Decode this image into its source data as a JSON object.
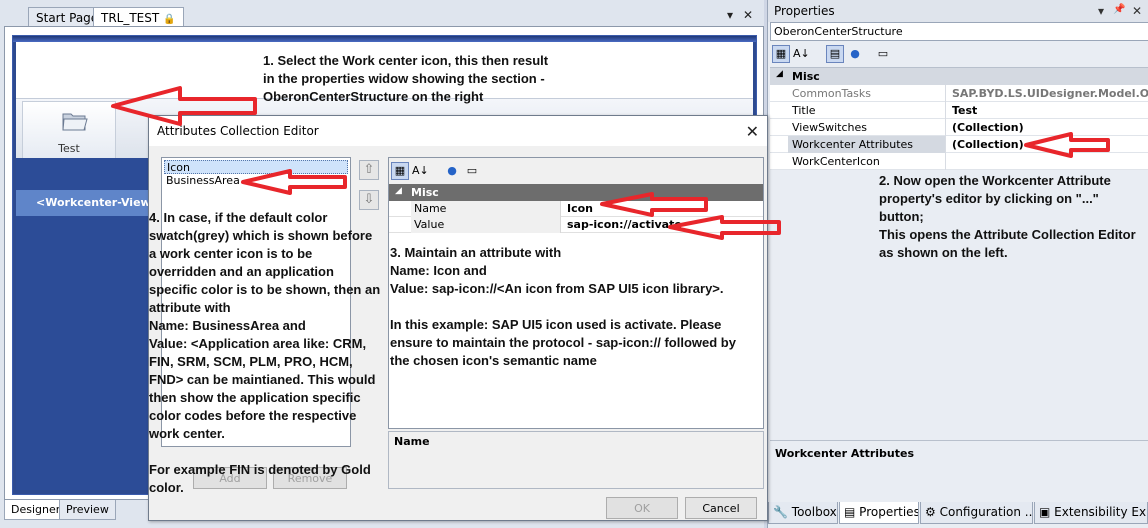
{
  "document": {
    "tabs": [
      {
        "label": "Start Page"
      },
      {
        "label": "TRL_TEST"
      }
    ],
    "pin_glyph": "🔒",
    "controls": {
      "dropdown": "▾",
      "close": "✕"
    },
    "bottom_tabs": [
      {
        "label": "Designer"
      },
      {
        "label": "Preview"
      }
    ]
  },
  "workcenter": {
    "tile_label": "Test",
    "tile_icon": "folder-icon",
    "view_title": "<Workcenter-View Titl"
  },
  "properties_panel": {
    "title": "Properties",
    "controls": {
      "dropdown": "▾",
      "pin": "📌",
      "close": "✕"
    },
    "selected_object": "OberonCenterStructure",
    "category": "Misc",
    "rows": [
      {
        "name": "CommonTasks",
        "value": "SAP.BYD.LS.UIDesigner.Model.Oberon"
      },
      {
        "name": "Title",
        "value": "Test"
      },
      {
        "name": "ViewSwitches",
        "value": "(Collection)"
      },
      {
        "name": "Workcenter Attributes",
        "value": "(Collection)"
      },
      {
        "name": "WorkCenterIcon",
        "value": ""
      }
    ],
    "description_title": "Workcenter Attributes",
    "bottom_tabs": [
      {
        "label": "Toolbox",
        "icon": "wrench-icon"
      },
      {
        "label": "Properties",
        "icon": "properties-icon"
      },
      {
        "label": "Configuration ...",
        "icon": "config-icon"
      },
      {
        "label": "Extensibility Ex...",
        "icon": "extensibility-icon"
      }
    ]
  },
  "dialog": {
    "title": "Attributes Collection Editor",
    "close_glyph": "✕",
    "members": [
      {
        "label": "Icon"
      },
      {
        "label": "BusinessArea"
      }
    ],
    "move_up_glyph": "⇧",
    "move_down_glyph": "⇩",
    "add_label": "Add",
    "remove_label": "Remove",
    "category": "Misc",
    "properties": [
      {
        "name": "Name",
        "value": "Icon"
      },
      {
        "name": "Value",
        "value": "sap-icon://activate"
      }
    ],
    "description_title": "Name",
    "ok_label": "OK",
    "cancel_label": "Cancel"
  },
  "annotations": {
    "step1": "1. Select the Work center icon, this then result\nin the properties widow showing the section -\nOberonCenterStructure on the right",
    "step2": "2. Now open the Workcenter Attribute\nproperty's editor by clicking on \"...\" button;\nThis opens the Attribute Collection Editor\nas shown on the left.",
    "step3": "3. Maintain an attribute with\nName: Icon and\nValue: sap-icon://<An icon from SAP UI5 icon library>.\n\nIn this example: SAP UI5 icon used is activate. Please\nensure to maintain the protocol - sap-icon:// followed by\nthe chosen icon's semantic name",
    "step4": "4. In case, if the default color\nswatch(grey) which is shown before\na work center icon is to be\noverridden and an application\nspecific color is to be shown, then an\nattribute with\nName: BusinessArea and\nValue: <Application area like: CRM,\nFIN, SRM, SCM, PLM, PRO, HCM,\nFND> can be maintianed. This would\nthen show the application specific\ncolor codes before the respective\nwork center.",
    "step4b": "For example FIN is denoted by Gold\ncolor."
  },
  "colors": {
    "arrow": "#e8262b",
    "workcenter_blue": "#2c4c97"
  }
}
